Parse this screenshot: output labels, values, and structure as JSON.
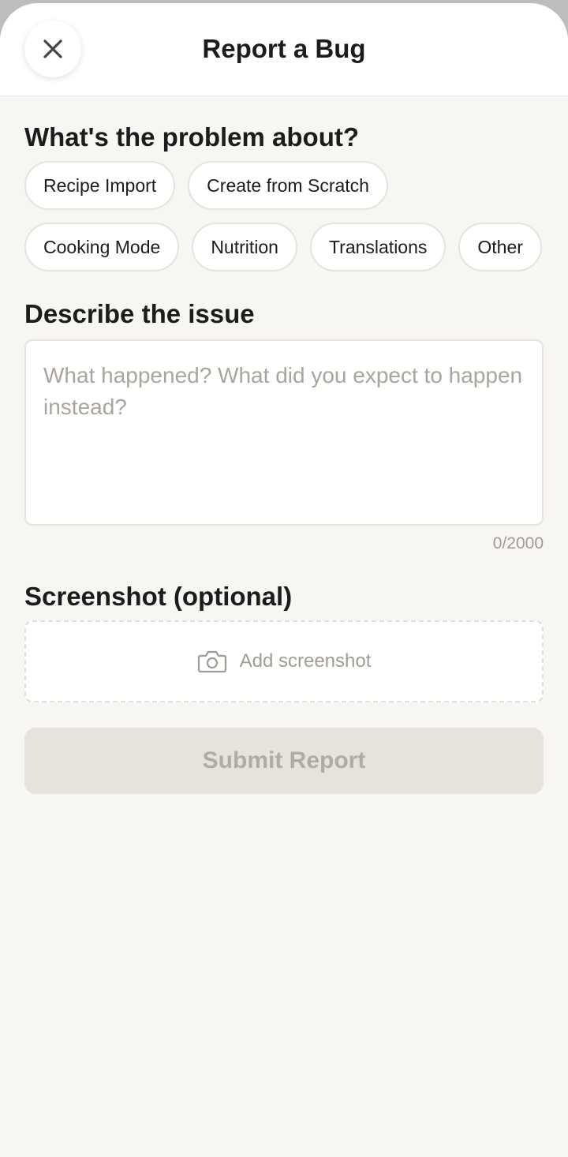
{
  "header": {
    "title": "Report a Bug",
    "close_icon": "close-icon"
  },
  "category": {
    "heading": "What's the problem about?",
    "options": [
      "Recipe Import",
      "Create from Scratch",
      "Cooking Mode",
      "Nutrition",
      "Translations",
      "Other"
    ],
    "selected": null
  },
  "description": {
    "heading": "Describe the issue",
    "placeholder": "What happened? What did you expect to happen instead?",
    "value": "",
    "counter": "0/2000"
  },
  "screenshot": {
    "heading": "Screenshot (optional)",
    "add_label": "Add screenshot",
    "icon": "camera-icon"
  },
  "submit": {
    "label": "Submit Report",
    "enabled": false
  },
  "colors": {
    "background": "#f7f6f2",
    "surface": "#ffffff",
    "border": "#e6e3dc",
    "text_primary": "#1c1c1c",
    "text_muted": "#a09c94",
    "submit_disabled_bg": "#e7e3dc",
    "submit_disabled_text": "#b1aca3"
  }
}
